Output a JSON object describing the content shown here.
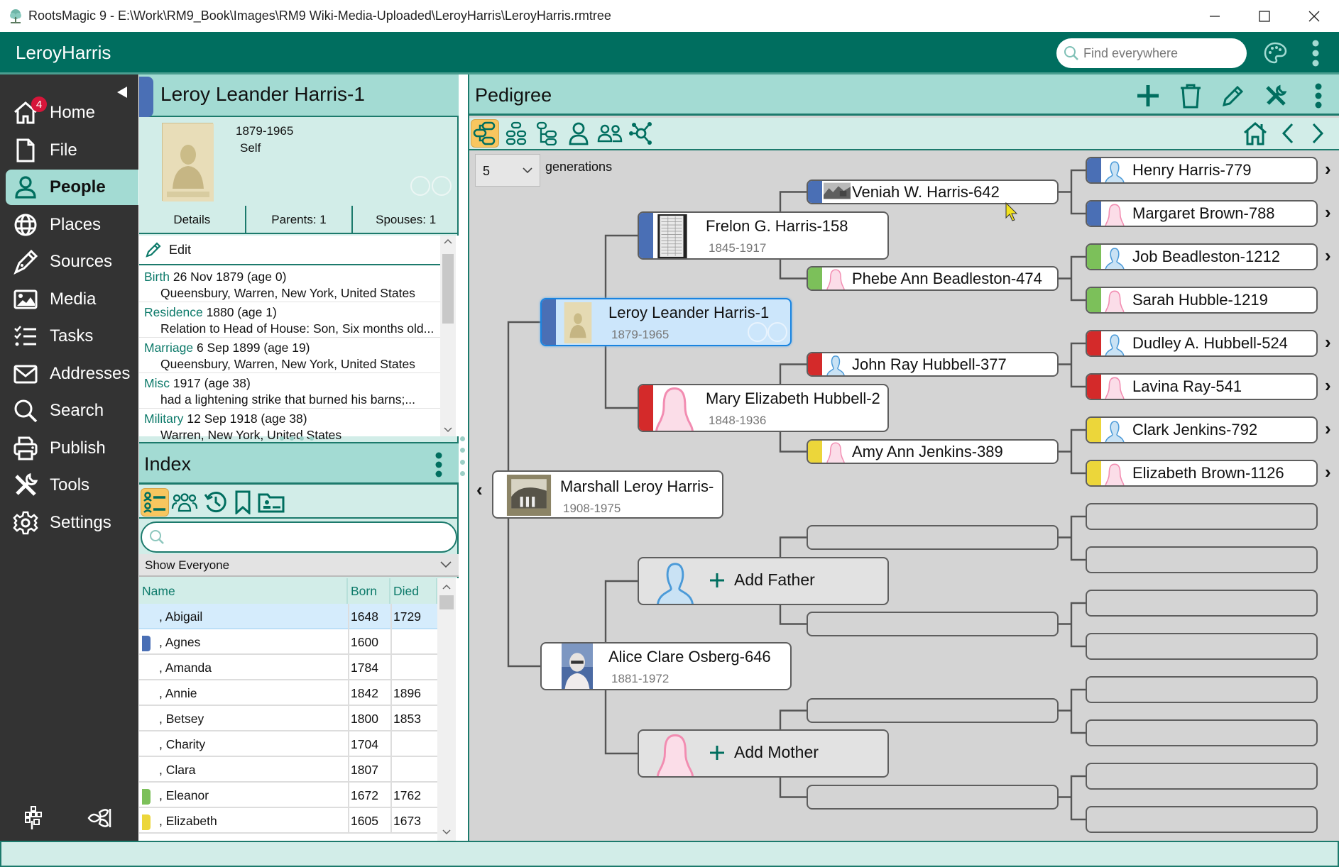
{
  "window": {
    "title": "RootsMagic 9 - E:\\Work\\RM9_Book\\Images\\RM9 Wiki-Media-Uploaded\\LeroyHarris\\LeroyHarris.rmtree",
    "controls": [
      "minimize",
      "maximize",
      "close"
    ]
  },
  "header": {
    "database_name": "LeroyHarris",
    "search_placeholder": "Find everywhere",
    "icons": [
      "palette-icon",
      "more-vert-icon"
    ]
  },
  "sidebar": {
    "collapse_icon": "triangle-left-icon",
    "items": [
      {
        "label": "Home",
        "icon": "home-icon",
        "badge": "4"
      },
      {
        "label": "File",
        "icon": "file-icon"
      },
      {
        "label": "People",
        "icon": "person-icon",
        "active": true
      },
      {
        "label": "Places",
        "icon": "globe-icon"
      },
      {
        "label": "Sources",
        "icon": "pen-nib-icon"
      },
      {
        "label": "Media",
        "icon": "image-icon"
      },
      {
        "label": "Tasks",
        "icon": "checklist-icon"
      },
      {
        "label": "Addresses",
        "icon": "envelope-icon"
      },
      {
        "label": "Search",
        "icon": "search-icon"
      },
      {
        "label": "Publish",
        "icon": "printer-icon"
      },
      {
        "label": "Tools",
        "icon": "tools-icon"
      },
      {
        "label": "Settings",
        "icon": "gear-icon"
      }
    ],
    "bottom_icons": [
      "familysearch-tree-icon",
      "ancestry-leaf-icon"
    ]
  },
  "person": {
    "name": "Leroy Leander Harris-1",
    "color": "#4a6fb5",
    "lifespan": "1879-1965",
    "relationship": "Self",
    "tabs": [
      "Details",
      "Parents: 1",
      "Spouses: 1"
    ],
    "edit_label": "Edit",
    "facts": [
      {
        "type": "Birth",
        "date": "26 Nov 1879 (age 0)",
        "detail": "Queensbury, Warren, New York, United States"
      },
      {
        "type": "Residence",
        "date": "1880 (age 1)",
        "detail": "Relation to Head of House: Son, Six months old..."
      },
      {
        "type": "Marriage",
        "date": "6 Sep 1899 (age 19)",
        "detail": "Queensbury, Warren, New York, United States"
      },
      {
        "type": "Misc",
        "date": "1917 (age 38)",
        "detail": "had a  lightening strike that burned his barns;..."
      },
      {
        "type": "Military",
        "date": "12 Sep 1918 (age 38)",
        "detail": "Warren, New York, United States"
      }
    ]
  },
  "index": {
    "title": "Index",
    "tools": [
      "name-list-icon",
      "groups-icon",
      "history-icon",
      "bookmark-icon",
      "person-folder-icon"
    ],
    "search_placeholder": "",
    "filter": "Show Everyone",
    "columns": [
      "Name",
      "Born",
      "Died"
    ],
    "rows": [
      {
        "name": ", Abigail",
        "born": "1648",
        "died": "1729",
        "color": "",
        "selected": true
      },
      {
        "name": ", Agnes",
        "born": "1600",
        "died": "",
        "color": "#4a6fb5"
      },
      {
        "name": ", Amanda",
        "born": "1784",
        "died": "",
        "color": ""
      },
      {
        "name": ", Annie",
        "born": "1842",
        "died": "1896",
        "color": ""
      },
      {
        "name": ", Betsey",
        "born": "1800",
        "died": "1853",
        "color": ""
      },
      {
        "name": ", Charity",
        "born": "1704",
        "died": "",
        "color": ""
      },
      {
        "name": ", Clara",
        "born": "1807",
        "died": "",
        "color": ""
      },
      {
        "name": ", Eleanor",
        "born": "1672",
        "died": "1762",
        "color": "#7cc05a"
      },
      {
        "name": ", Elizabeth",
        "born": "1605",
        "died": "1673",
        "color": "#ecd63a"
      }
    ]
  },
  "pedigree": {
    "title": "Pedigree",
    "header_actions": [
      "add-icon",
      "delete-icon",
      "edit-icon",
      "tools-icon",
      "more-vert-icon"
    ],
    "view_tools": [
      "pedigree-view-icon",
      "family-view-icon",
      "descendants-view-icon",
      "individual-view-icon",
      "people-view-icon",
      "network-view-icon"
    ],
    "nav_icons": [
      "home-icon",
      "back-icon",
      "forward-icon"
    ],
    "generations": "5",
    "generations_label": "generations",
    "child": {
      "name": "Marshall Leroy Harris-",
      "dates": "1908-1975",
      "photo": "group-photo"
    },
    "people": [
      {
        "id": "root",
        "name": "Leroy Leander Harris-1",
        "dates": "1879-1965",
        "color": "#4a6fb5",
        "photo": "portrait",
        "selected": true
      },
      {
        "id": "spouse",
        "name": "Alice Clare Osberg-646",
        "dates": "1881-1972",
        "color": "",
        "photo": "portrait-color"
      },
      {
        "id": "f",
        "name": "Frelon G. Harris-158",
        "dates": "1845-1917",
        "color": "#4a6fb5",
        "photo": "document"
      },
      {
        "id": "m",
        "name": "Mary Elizabeth Hubbell-2",
        "dates": "1848-1936",
        "color": "#d42a2a",
        "photo": "female"
      },
      {
        "id": "ff",
        "name": "Veniah W. Harris-642",
        "color": "#4a6fb5",
        "photo": "landscape"
      },
      {
        "id": "fm",
        "name": "Phebe Ann Beadleston-474",
        "color": "#7cc05a",
        "photo": "female"
      },
      {
        "id": "mf",
        "name": "John Ray Hubbell-377",
        "color": "#d42a2a",
        "photo": "male"
      },
      {
        "id": "mm",
        "name": "Amy Ann Jenkins-389",
        "color": "#ecd63a",
        "photo": "female"
      },
      {
        "id": "fff",
        "name": "Henry Harris-779",
        "color": "#4a6fb5",
        "photo": "male",
        "more": true
      },
      {
        "id": "ffm",
        "name": "Margaret Brown-788",
        "color": "#4a6fb5",
        "photo": "female",
        "more": true
      },
      {
        "id": "fmf",
        "name": "Job Beadleston-1212",
        "color": "#7cc05a",
        "photo": "male",
        "more": true
      },
      {
        "id": "fmm",
        "name": "Sarah Hubble-1219",
        "color": "#7cc05a",
        "photo": "female",
        "more": false
      },
      {
        "id": "mff",
        "name": "Dudley A. Hubbell-524",
        "color": "#d42a2a",
        "photo": "male",
        "more": true
      },
      {
        "id": "mfm",
        "name": "Lavina Ray-541",
        "color": "#d42a2a",
        "photo": "female",
        "more": true
      },
      {
        "id": "mmf",
        "name": "Clark Jenkins-792",
        "color": "#ecd63a",
        "photo": "male",
        "more": true
      },
      {
        "id": "mmm",
        "name": "Elizabeth Brown-1126",
        "color": "#ecd63a",
        "photo": "female",
        "more": true
      }
    ],
    "add_father_label": "Add Father",
    "add_mother_label": "Add Mother",
    "more_glyph": "›",
    "back_glyph": "‹"
  }
}
